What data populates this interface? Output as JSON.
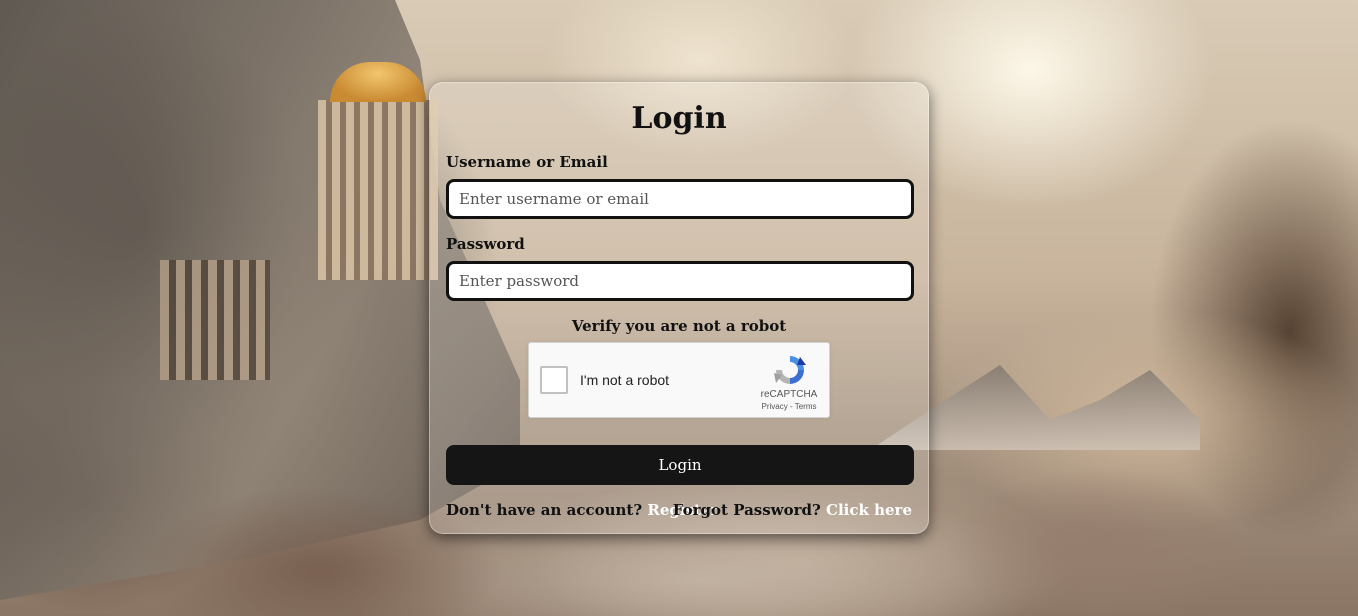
{
  "login_form": {
    "title": "Login",
    "username_label": "Username or Email",
    "username_placeholder": "Enter username or email",
    "password_label": "Password",
    "password_placeholder": "Enter password",
    "verify_text": "Verify you are not a robot",
    "submit_label": "Login"
  },
  "recaptcha": {
    "checkbox_label": "I'm not a robot",
    "brand": "reCAPTCHA",
    "privacy": "Privacy",
    "separator": " - ",
    "terms": "Terms",
    "icon": "recaptcha-logo-icon"
  },
  "footer": {
    "no_account_text": "Don't have an account?",
    "register_link": "Register",
    "forgot_text": "Forgot Password?",
    "forgot_link": "Click here"
  },
  "colors": {
    "button_bg": "#151515",
    "link_color": "#ffffff",
    "text_color": "#111111"
  }
}
